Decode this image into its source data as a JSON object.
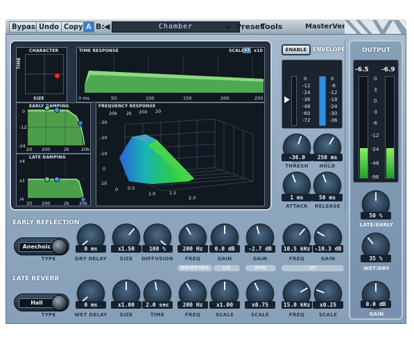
{
  "toolbar": {
    "bypass": "Bypass",
    "undo": "Undo",
    "copy": "Copy",
    "ab_a": "A",
    "ab_b": "B:",
    "preset_name": "Chamber",
    "preset": "Preset",
    "tools": "Tools",
    "title": "MasterVerb"
  },
  "display": {
    "character": {
      "title": "CHARACTER",
      "y_label": "TIME",
      "x_label": "SIZE"
    },
    "time_response": {
      "title": "TIME RESPONSE",
      "scale_label": "SCALE",
      "scale_x1": "x1",
      "scale_x10": "x10",
      "x_ticks": [
        "0 ms",
        "50",
        "100",
        "150",
        "200",
        "250"
      ]
    },
    "early_damping": {
      "title": "EARLY DAMPING",
      "y_ticks": [
        "0",
        "-12",
        "-24"
      ],
      "x_ticks": [
        "20",
        "200",
        "2k",
        "20k"
      ]
    },
    "late_damping": {
      "title": "LATE DAMPING",
      "y_ticks": [
        "x4",
        "x1",
        "/4"
      ],
      "x_ticks": [
        "20",
        "200",
        "2k",
        "20k"
      ]
    },
    "frequency_response": {
      "title": "FREQUENCY RESPONSE",
      "top_ticks": [
        "20k",
        "2k",
        "200",
        "20"
      ],
      "z_ticks": [
        "-30",
        "-20",
        "-10",
        "0",
        "10"
      ],
      "time_ticks": [
        "0",
        "0.5",
        "1.0",
        "1.5",
        "2.0"
      ]
    }
  },
  "envelope": {
    "enable": "ENABLE",
    "title": "ENVELOPE",
    "scale": [
      "0",
      "-12",
      "-24",
      "-36",
      "-48",
      "-60",
      "-72"
    ],
    "scale_right": [
      "0",
      "-6",
      "-12",
      "-18",
      "-24",
      "-30",
      "-36"
    ],
    "thresh": {
      "value": "-36.0",
      "label": "THRESH"
    },
    "hold": {
      "value": "250 ms",
      "label": "HOLD"
    },
    "attack": {
      "value": "1 ms",
      "label": "ATTACK"
    },
    "release": {
      "value": "50 ms",
      "label": "RELEASE"
    }
  },
  "output": {
    "title": "OUTPUT",
    "peak_left": "-6.5",
    "peak_right": "-6.9",
    "scale": [
      "0",
      "3",
      "0",
      "-3",
      "-6",
      "-12",
      "-24",
      "-48",
      "-96"
    ],
    "level_left": 0.3,
    "level_right": 0.3,
    "late_early": {
      "value": "50 %",
      "label": "LATE/EARLY"
    },
    "wet_dry": {
      "value": "35 %",
      "label": "WET/DRY"
    },
    "gain": {
      "value": "0.0 dB",
      "label": "GAIN"
    }
  },
  "early_reflection": {
    "title": "EARLY REFLECTION",
    "type": {
      "value": "Anechoic",
      "label": "TYPE"
    },
    "dry_delay": {
      "value": "0 ms",
      "label": "DRY DELAY"
    },
    "size": {
      "value": "x1.50",
      "label": "SIZE"
    },
    "diffusion": {
      "value": "100 %",
      "label": "DIFFUSION"
    },
    "lo_freq": {
      "value": "200 Hz",
      "label": "FREQ"
    },
    "lo_gain": {
      "value": "0.0 dB",
      "label": "GAIN"
    },
    "mid_gain": {
      "value": "-2.7 dB",
      "label": "GAIN"
    },
    "hi_freq": {
      "value": "10.5 kHz",
      "label": "FREQ"
    },
    "hi_gain": {
      "value": "-10.3 dB",
      "label": "GAIN"
    }
  },
  "bands": {
    "damping": "DAMPING",
    "lo": "LO",
    "mid": "MID",
    "hi": "HI"
  },
  "late_reverb": {
    "title": "LATE REVERB",
    "type": {
      "value": "Hall",
      "label": "TYPE"
    },
    "wet_delay": {
      "value": "0 ms",
      "label": "WET DELAY"
    },
    "size": {
      "value": "x1.00",
      "label": "SIZE"
    },
    "time": {
      "value": "2.0 sec",
      "label": "TIME"
    },
    "lo_freq": {
      "value": "200 Hz",
      "label": "FREQ"
    },
    "lo_scale": {
      "value": "x1.00",
      "label": "SCALE"
    },
    "mid_scale": {
      "value": "x0.75",
      "label": "SCALE"
    },
    "hi_freq": {
      "value": "15.0 kHz",
      "label": "FREQ"
    },
    "hi_scale": {
      "value": "x0.25",
      "label": "SCALE"
    }
  },
  "colors": {
    "accent_blue": "#2f7fd0",
    "meter_green": "#36d12e",
    "display_bg": "#111820"
  }
}
